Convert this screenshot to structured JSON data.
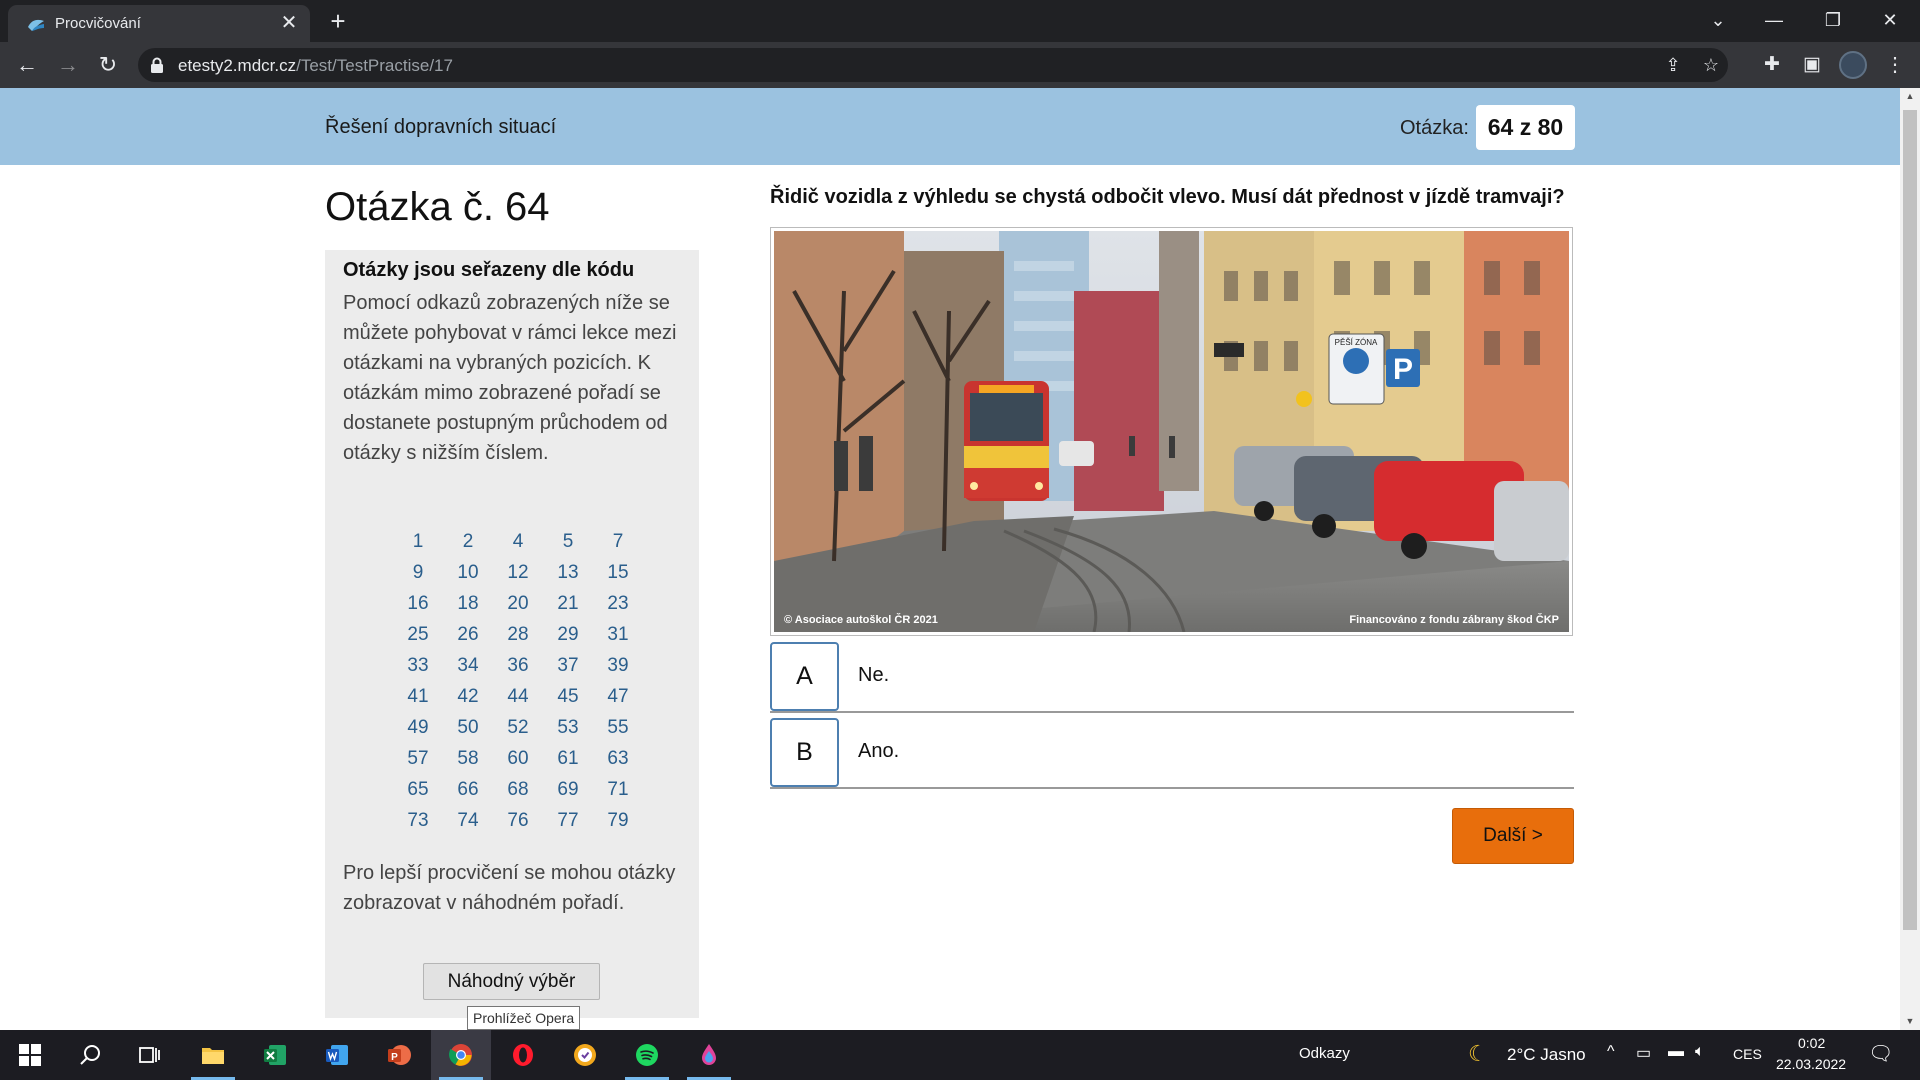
{
  "browser": {
    "tab_title": "Procvičování",
    "tab_close": "✕",
    "new_tab": "+",
    "url_host": "etesty2.mdcr.cz",
    "url_path": "/Test/TestPractise/17"
  },
  "header": {
    "section_title": "Řešení dopravních situací",
    "counter_label": "Otázka:",
    "counter_value": "64 z 80"
  },
  "question": {
    "number_title": "Otázka č. 64",
    "text": "Řidič vozidla z výhledu se chystá odbočit vlevo. Musí dát přednost v jízdě tramvaji?",
    "photo_caption_left": "© Asociace autoškol ČR 2021",
    "photo_caption_right": "Financováno z fondu zábrany škod ČKP",
    "photo_sign_text": "PĚŠÍ ZÓNA",
    "answers": [
      {
        "key": "A",
        "text": "Ne."
      },
      {
        "key": "B",
        "text": "Ano."
      }
    ],
    "next_label": "Další >"
  },
  "side_panel": {
    "heading": "Otázky jsou seřazeny dle kódu",
    "description": "Pomocí odkazů zobrazených níže se můžete pohybovat v rámci lekce mezi otázkami na vybraných pozicích. K otázkám mimo zobrazené pořadí se dostanete postupným průchodem od otázky s nižším číslem.",
    "question_links": [
      [
        "1",
        "2",
        "4",
        "5",
        "7"
      ],
      [
        "9",
        "10",
        "12",
        "13",
        "15"
      ],
      [
        "16",
        "18",
        "20",
        "21",
        "23"
      ],
      [
        "25",
        "26",
        "28",
        "29",
        "31"
      ],
      [
        "33",
        "34",
        "36",
        "37",
        "39"
      ],
      [
        "41",
        "42",
        "44",
        "45",
        "47"
      ],
      [
        "49",
        "50",
        "52",
        "53",
        "55"
      ],
      [
        "57",
        "58",
        "60",
        "61",
        "63"
      ],
      [
        "65",
        "66",
        "68",
        "69",
        "71"
      ],
      [
        "73",
        "74",
        "76",
        "77",
        "79"
      ]
    ],
    "random_text": "Pro lepší procvičení se mohou otázky zobrazovat v náhodném pořadí.",
    "random_button": "Náhodný výběr"
  },
  "tooltip": "Prohlížeč Opera",
  "taskbar": {
    "links_label": "Odkazy",
    "weather": "2°C Jasno",
    "language": "CES",
    "time": "0:02",
    "date": "22.03.2022"
  },
  "colors": {
    "header_band": "#9bc2e0",
    "link": "#2a5e8c",
    "next_button": "#e86e0c",
    "answer_border": "#4d7fb0"
  }
}
